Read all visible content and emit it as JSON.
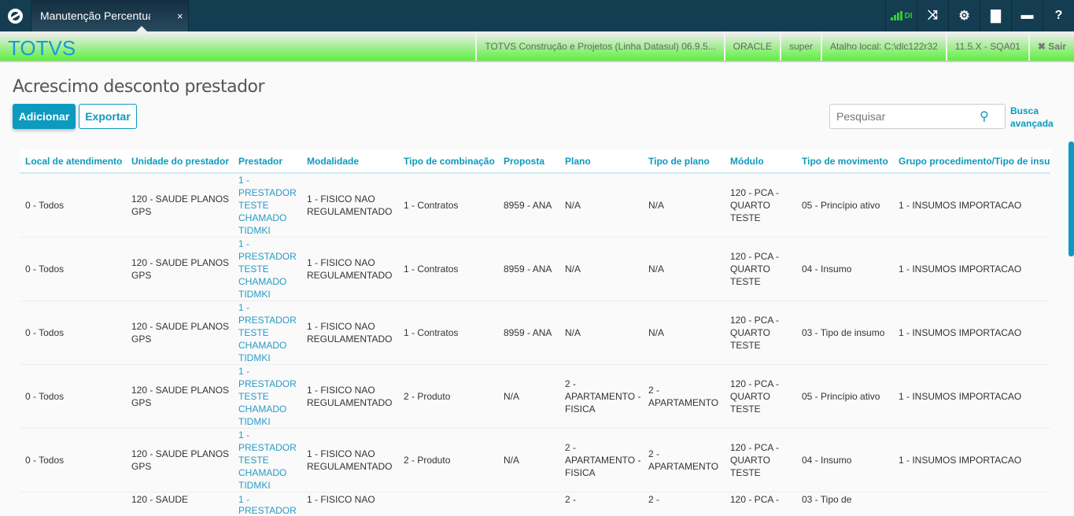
{
  "topbar": {
    "tab_title": "Manutenção Percentual",
    "tab_close": "×",
    "signal_label": "DI"
  },
  "header": {
    "brand": "TOTVS",
    "product": "TOTVS Construção e Projetos (Linha Datasul) 06.9.5...",
    "database": "ORACLE",
    "user": "super",
    "shortcut": "Atalho local: C:\\dlc122r32",
    "version": "11.5.X - SQA01",
    "logout": "✖ Sair"
  },
  "page": {
    "title": "Acrescimo desconto prestador",
    "add_label": "Adicionar",
    "export_label": "Exportar",
    "search_placeholder": "Pesquisar",
    "advanced_search": "Busca avançada"
  },
  "colors": {
    "accent": "#0c9abe",
    "topbar": "#153d52",
    "green": "#5def3d"
  },
  "table": {
    "columns": [
      "Local de atendimento",
      "Unidade do prestador",
      "Prestador",
      "Modalidade",
      "Tipo de combinação",
      "Proposta",
      "Plano",
      "Tipo de plano",
      "Módulo",
      "Tipo de movimento",
      "Grupo procedimento/Tipo de insumo"
    ],
    "rows": [
      [
        "0 - Todos",
        "120 - SAUDE PLANOS GPS",
        "1 - PRESTADOR TESTE CHAMADO TIDMKI",
        "1 - FISICO NAO REGULAMENTADO",
        "1 - Contratos",
        "8959 - ANA",
        "N/A",
        "N/A",
        "120 - PCA - QUARTO TESTE",
        "05 - Princípio ativo",
        "1 - INSUMOS IMPORTACAO"
      ],
      [
        "0 - Todos",
        "120 - SAUDE PLANOS GPS",
        "1 - PRESTADOR TESTE CHAMADO TIDMKI",
        "1 - FISICO NAO REGULAMENTADO",
        "1 - Contratos",
        "8959 - ANA",
        "N/A",
        "N/A",
        "120 - PCA - QUARTO TESTE",
        "04 - Insumo",
        "1 - INSUMOS IMPORTACAO"
      ],
      [
        "0 - Todos",
        "120 - SAUDE PLANOS GPS",
        "1 - PRESTADOR TESTE CHAMADO TIDMKI",
        "1 - FISICO NAO REGULAMENTADO",
        "1 - Contratos",
        "8959 - ANA",
        "N/A",
        "N/A",
        "120 - PCA - QUARTO TESTE",
        "03 - Tipo de insumo",
        "1 - INSUMOS IMPORTACAO"
      ],
      [
        "0 - Todos",
        "120 - SAUDE PLANOS GPS",
        "1 - PRESTADOR TESTE CHAMADO TIDMKI",
        "1 - FISICO NAO REGULAMENTADO",
        "2 - Produto",
        "N/A",
        "2 - APARTAMENTO - FISICA",
        "2 - APARTAMENTO",
        "120 - PCA - QUARTO TESTE",
        "05 - Princípio ativo",
        "1 - INSUMOS IMPORTACAO"
      ],
      [
        "0 - Todos",
        "120 - SAUDE PLANOS GPS",
        "1 - PRESTADOR TESTE CHAMADO TIDMKI",
        "1 - FISICO NAO REGULAMENTADO",
        "2 - Produto",
        "N/A",
        "2 - APARTAMENTO - FISICA",
        "2 - APARTAMENTO",
        "120 - PCA - QUARTO TESTE",
        "04 - Insumo",
        "1 - INSUMOS IMPORTACAO"
      ],
      [
        "",
        "120 - SAUDE",
        "1 - PRESTADOR",
        "1 - FISICO NAO",
        "",
        "",
        "2 -",
        "2 -",
        "120 - PCA -",
        "03 - Tipo de",
        ""
      ]
    ]
  }
}
